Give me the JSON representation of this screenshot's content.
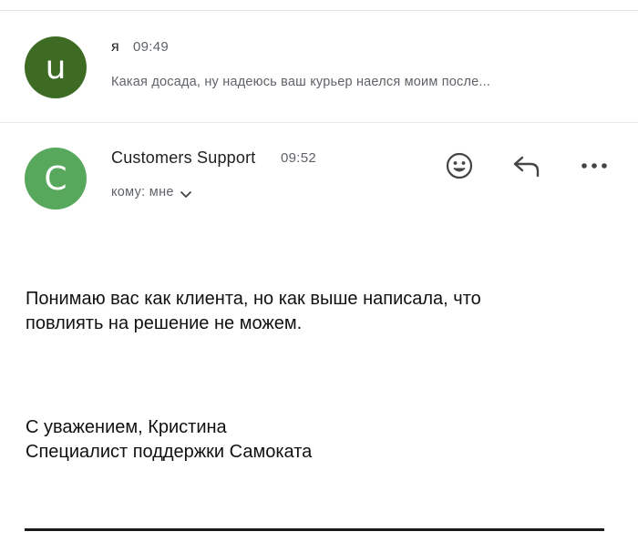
{
  "collapsed_message": {
    "sender": "я",
    "time": "09:49",
    "snippet": "Какая досада, ну надеюсь ваш курьер наелся моим после...",
    "avatar": {
      "letter": "u",
      "color": "#3d6b24"
    }
  },
  "open_message": {
    "sender": "Customers Support",
    "time": "09:52",
    "recipient_label": "кому: мне",
    "avatar": {
      "letter": "C",
      "color": "#57a85c"
    },
    "actions": {
      "emoji_icon": "smiley-face-icon",
      "reply_icon": "reply-arrow-icon",
      "more_icon": "more-dots-icon"
    },
    "body_lines": [
      "Понимаю вас как клиента, но как выше написала, что",
      "повлиять на решение не можем."
    ],
    "signature_lines": [
      "С уважением, Кристина",
      "Специалист поддержки Самоката"
    ]
  }
}
